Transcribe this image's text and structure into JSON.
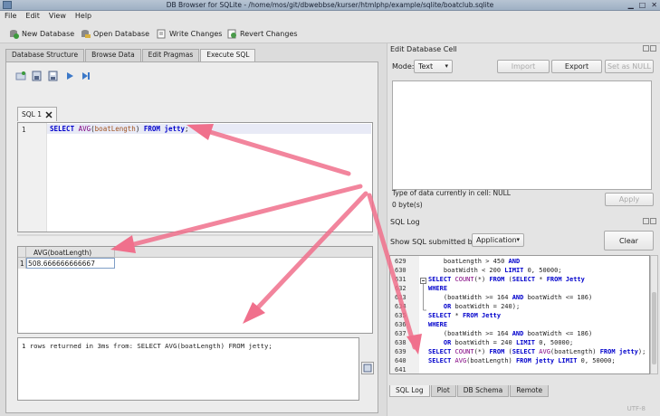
{
  "window": {
    "title": "DB Browser for SQLite - /home/mos/git/dbwebbse/kurser/htmlphp/example/sqlite/boatclub.sqlite"
  },
  "menu": [
    "File",
    "Edit",
    "View",
    "Help"
  ],
  "toolbar": {
    "new_db": "New Database",
    "open_db": "Open Database",
    "write": "Write Changes",
    "revert": "Revert Changes"
  },
  "tabs": [
    "Database Structure",
    "Browse Data",
    "Edit Pragmas",
    "Execute SQL"
  ],
  "sql_tab": "SQL 1",
  "editor": {
    "line": "1",
    "keyword1": "SELECT",
    "fn": "AVG",
    "arg": "boatLength",
    "keyword2": "FROM",
    "table": "jetty"
  },
  "results": {
    "column": "AVG(boatLength)",
    "rownum": "1",
    "value": "508.666666666667"
  },
  "message": "1 rows returned in 3ms from: SELECT AVG(boatLength) FROM jetty;",
  "edit_cell": {
    "title": "Edit Database Cell",
    "mode_label": "Mode:",
    "mode_value": "Text",
    "import": "Import",
    "export": "Export",
    "set_null": "Set as NULL",
    "type_info": "Type of data currently in cell: NULL",
    "size_info": "0 byte(s)",
    "apply": "Apply"
  },
  "sql_log": {
    "title": "SQL Log",
    "show_label": "Show SQL submitted by",
    "submitter": "Application",
    "clear": "Clear",
    "lines": [
      {
        "n": "629",
        "c": "    boatLength > 450 AND"
      },
      {
        "n": "630",
        "c": "    boatWidth < 200 LIMIT 0, 50000;"
      },
      {
        "n": "631",
        "c": "SELECT COUNT(*) FROM (SELECT * FROM Jetty"
      },
      {
        "n": "632",
        "c": "WHERE"
      },
      {
        "n": "633",
        "c": "    (boatWidth >= 164 AND boatWidth <= 186)"
      },
      {
        "n": "634",
        "c": "    OR boatWidth = 240);"
      },
      {
        "n": "635",
        "c": "SELECT * FROM Jetty"
      },
      {
        "n": "636",
        "c": "WHERE"
      },
      {
        "n": "637",
        "c": "    (boatWidth >= 164 AND boatWidth <= 186)"
      },
      {
        "n": "638",
        "c": "    OR boatWidth = 240 LIMIT 0, 50000;"
      },
      {
        "n": "639",
        "c": "SELECT COUNT(*) FROM (SELECT AVG(boatLength) FROM jetty);"
      },
      {
        "n": "640",
        "c": "SELECT AVG(boatLength) FROM jetty LIMIT 0, 50000;"
      },
      {
        "n": "641",
        "c": ""
      }
    ]
  },
  "bottom_tabs": [
    "SQL Log",
    "Plot",
    "DB Schema",
    "Remote"
  ],
  "status": "UTF-8",
  "colors": {
    "arrow": "#f0708c",
    "keyword": "#0000cc"
  }
}
